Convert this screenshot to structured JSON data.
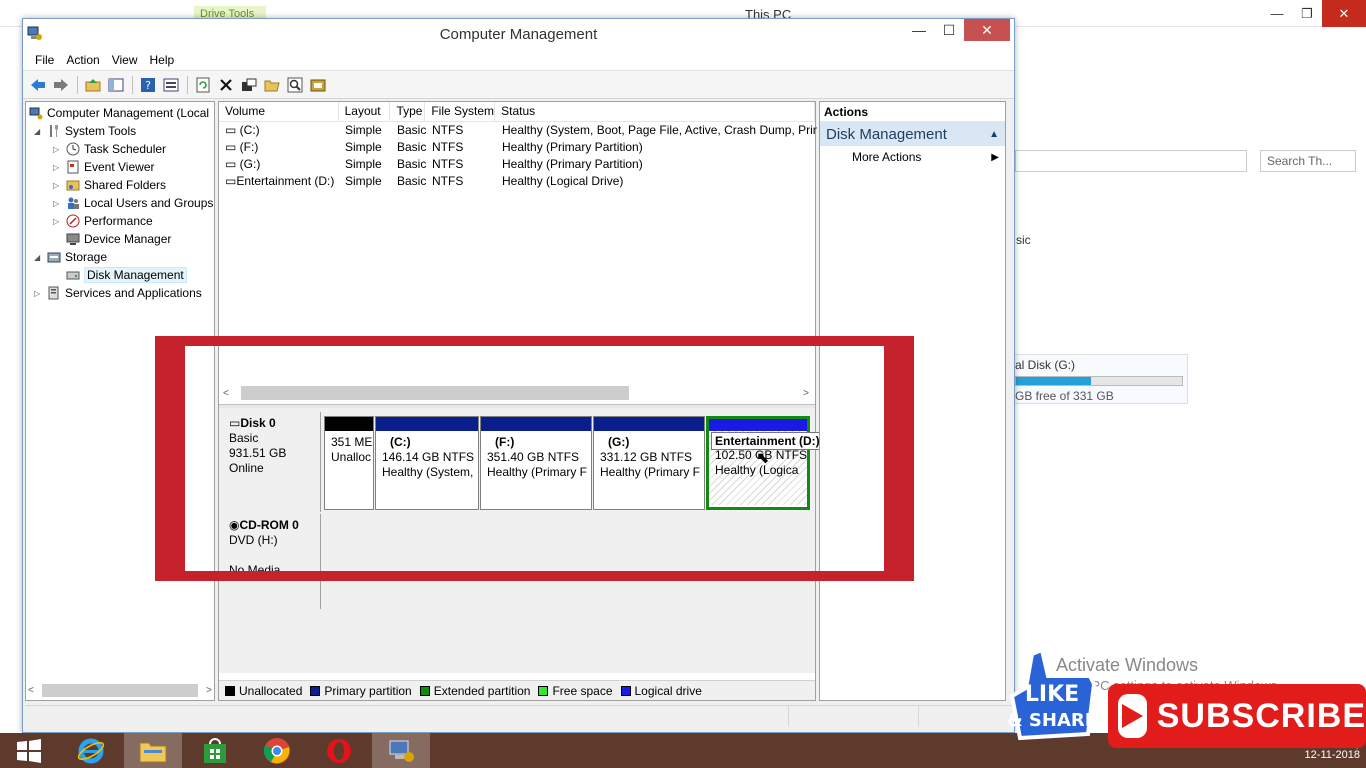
{
  "background": {
    "drive_tools": "Drive Tools",
    "this_pc": "This PC",
    "search_placeholder": "Search Th...",
    "partial_text": "sic",
    "disk_name": "al Disk (G:)",
    "disk_free": "GB free of 331 GB",
    "disk_fill_fraction": 0.45,
    "activate_title": "Activate Windows",
    "activate_sub": "Go to PC settings to activate Windows."
  },
  "window": {
    "title": "Computer Management",
    "minimize": "—",
    "maximize": "☐",
    "close": "✕"
  },
  "menu": [
    "File",
    "Action",
    "View",
    "Help"
  ],
  "tree": {
    "root": "Computer Management (Local",
    "system_tools": "System Tools",
    "task_scheduler": "Task Scheduler",
    "event_viewer": "Event Viewer",
    "shared_folders": "Shared Folders",
    "local_users": "Local Users and Groups",
    "performance": "Performance",
    "device_manager": "Device Manager",
    "storage": "Storage",
    "disk_management": "Disk Management",
    "services": "Services and Applications"
  },
  "volumes": {
    "headers": [
      "Volume",
      "Layout",
      "Type",
      "File System",
      "Status"
    ],
    "rows": [
      {
        "volume": "(C:)",
        "layout": "Simple",
        "type": "Basic",
        "fs": "NTFS",
        "status": "Healthy (System, Boot, Page File, Active, Crash Dump, Prim"
      },
      {
        "volume": "(F:)",
        "layout": "Simple",
        "type": "Basic",
        "fs": "NTFS",
        "status": "Healthy (Primary Partition)"
      },
      {
        "volume": "(G:)",
        "layout": "Simple",
        "type": "Basic",
        "fs": "NTFS",
        "status": "Healthy (Primary Partition)"
      },
      {
        "volume": "Entertainment (D:)",
        "layout": "Simple",
        "type": "Basic",
        "fs": "NTFS",
        "status": "Healthy (Logical Drive)"
      }
    ]
  },
  "disk0": {
    "name": "Disk 0",
    "type": "Basic",
    "size": "931.51 GB",
    "state": "Online",
    "partitions": [
      {
        "title": "",
        "line1": "351 ME",
        "line2": "Unalloc"
      },
      {
        "title": "(C:)",
        "line1": "146.14 GB NTFS",
        "line2": "Healthy (System,"
      },
      {
        "title": "(F:)",
        "line1": "351.40 GB NTFS",
        "line2": "Healthy (Primary F"
      },
      {
        "title": "(G:)",
        "line1": "331.12 GB NTFS",
        "line2": "Healthy (Primary F"
      },
      {
        "title": "",
        "line1": "102.50 GB NTFS",
        "line2": "Healthy (Logica"
      }
    ],
    "tooltip": "Entertainment  (D:)"
  },
  "cdrom": {
    "name": "CD-ROM 0",
    "type": "DVD (H:)",
    "media": "No Media"
  },
  "legend": [
    {
      "label": "Unallocated",
      "color": "#000000"
    },
    {
      "label": "Primary partition",
      "color": "#0a1e8c"
    },
    {
      "label": "Extended partition",
      "color": "#138a13"
    },
    {
      "label": "Free space",
      "color": "#33e633"
    },
    {
      "label": "Logical drive",
      "color": "#1a1ae6"
    }
  ],
  "actions": {
    "title": "Actions",
    "section": "Disk Management",
    "more": "More Actions"
  },
  "taskbar": {
    "date": "12-11-2018"
  },
  "overlays": {
    "like": "LIKE",
    "share": "& SHARE",
    "subscribe": "SUBSCRIBE"
  }
}
